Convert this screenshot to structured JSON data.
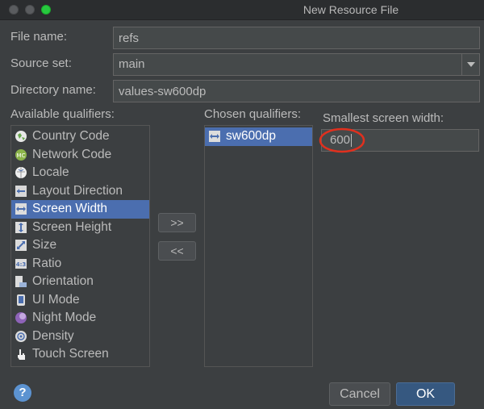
{
  "window": {
    "title": "New Resource File"
  },
  "form": {
    "file_name_label": "File name:",
    "file_name_value": "refs",
    "source_set_label": "Source set:",
    "source_set_value": "main",
    "directory_name_label": "Directory name:",
    "directory_name_value": "values-sw600dp"
  },
  "available": {
    "label": "Available qualifiers:",
    "items": [
      {
        "label": "Country Code",
        "icon": "country-code-icon"
      },
      {
        "label": "Network Code",
        "icon": "network-code-icon"
      },
      {
        "label": "Locale",
        "icon": "locale-globe-icon"
      },
      {
        "label": "Layout Direction",
        "icon": "layout-direction-icon"
      },
      {
        "label": "Screen Width",
        "icon": "screen-width-icon",
        "selected": true
      },
      {
        "label": "Screen Height",
        "icon": "screen-height-icon"
      },
      {
        "label": "Size",
        "icon": "size-icon"
      },
      {
        "label": "Ratio",
        "icon": "ratio-icon"
      },
      {
        "label": "Orientation",
        "icon": "orientation-icon"
      },
      {
        "label": "UI Mode",
        "icon": "ui-mode-icon"
      },
      {
        "label": "Night Mode",
        "icon": "night-mode-icon"
      },
      {
        "label": "Density",
        "icon": "density-icon"
      },
      {
        "label": "Touch Screen",
        "icon": "touch-screen-icon"
      }
    ]
  },
  "transfer": {
    "add_label": ">>",
    "remove_label": "<<"
  },
  "chosen": {
    "label": "Chosen qualifiers:",
    "items": [
      {
        "label": "sw600dp",
        "icon": "screen-width-icon",
        "selected": true
      }
    ]
  },
  "smallest_width": {
    "label": "Smallest screen width:",
    "value": "600"
  },
  "footer": {
    "help_label": "?",
    "cancel_label": "Cancel",
    "ok_label": "OK"
  },
  "colors": {
    "selection": "#4b6eaf",
    "background": "#3c3f41",
    "annotation_circle": "#e0301e"
  }
}
